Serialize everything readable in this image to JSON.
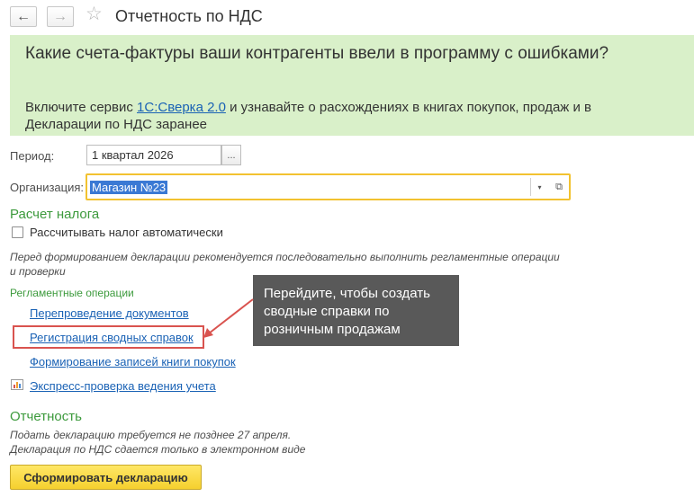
{
  "window": {
    "title": "Отчетность по НДС",
    "back_glyph": "←",
    "forward_glyph": "→",
    "star_glyph": "☆"
  },
  "banner": {
    "title": "Какие счета-фактуры ваши контрагенты ввели в программу с ошибками?",
    "text_before": "Включите сервис ",
    "link": "1С:Сверка 2.0",
    "text_after": " и узнавайте о расхождениях в книгах покупок, продаж и в Декларации по НДС заранее",
    "background_color": "#d9f0c9"
  },
  "period": {
    "label": "Период:",
    "value": "1 квартал 2026",
    "select_button": "..."
  },
  "organization": {
    "label": "Организация:",
    "value": "Магазин №23",
    "dropdown_glyph": "▾",
    "open_glyph": "⧉",
    "highlight_color": "#f2c230"
  },
  "tax_calc": {
    "title": "Расчет налога",
    "checkbox_label": "Рассчитывать налог автоматически",
    "checkbox_checked": false
  },
  "note": "Перед формированием декларации рекомендуется последовательно выполнить регламентные операции и проверки",
  "routine_ops": {
    "title": "Регламентные операции",
    "links": [
      "Перепроведение документов",
      "Регистрация сводных справок",
      "Формирование записей книги покупок"
    ]
  },
  "express_check": {
    "icon": "chart-icon",
    "label": "Экспресс-проверка ведения учета"
  },
  "callout": {
    "text": "Перейдите, чтобы создать сводные справки по розничным продажам",
    "background_color": "#595959",
    "arrow_color": "#d9534f"
  },
  "reporting": {
    "title": "Отчетность",
    "lines": [
      "Подать декларацию требуется не позднее 27 апреля.",
      "Декларация по НДС сдается только в электронном виде"
    ],
    "submit_button": "Сформировать декларацию"
  },
  "colors": {
    "link": "#1a62b5",
    "section_title": "#3c9a3c",
    "button_yellow": "#f5d02e"
  }
}
